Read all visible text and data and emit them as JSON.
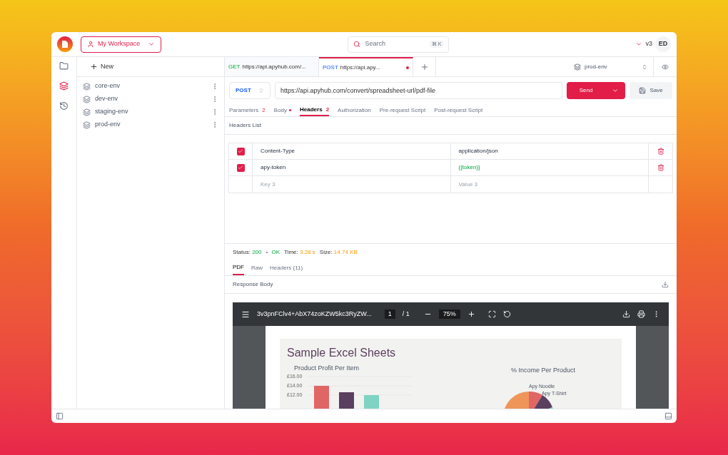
{
  "topbar": {
    "workspace": "My Workspace",
    "search": {
      "placeholder": "Search",
      "shortcut": "⌘ K"
    },
    "version": "v3",
    "avatar": "ED"
  },
  "rail": [
    {
      "kind": "folder",
      "selected": false
    },
    {
      "kind": "environments",
      "selected": true
    },
    {
      "kind": "history",
      "selected": false
    }
  ],
  "sidebar": {
    "new_label": "New",
    "items": [
      {
        "label": "core-env"
      },
      {
        "label": "dev-env"
      },
      {
        "label": "staging-env"
      },
      {
        "label": "prod-env"
      }
    ]
  },
  "request_tabs": [
    {
      "method": "GET",
      "url": "https://api.apyhub.com/...",
      "selected": false,
      "unsaved": false
    },
    {
      "method": "POST",
      "url": "https://api.apy...",
      "selected": true,
      "unsaved": true
    }
  ],
  "environment": "prod-env",
  "request": {
    "method": "POST",
    "url": "https://api.apyhub.com/convert/spreadsheet-url/pdf-file",
    "send": "Send",
    "save": "Save"
  },
  "sub_tabs": [
    {
      "label": "Parameters",
      "count": "2",
      "dot": false,
      "selected": false
    },
    {
      "label": "Body",
      "dot": true,
      "selected": false
    },
    {
      "label": "Headers",
      "count": "2",
      "dot": false,
      "selected": true
    },
    {
      "label": "Authorization",
      "dot": false,
      "selected": false
    },
    {
      "label": "Pre-request Script",
      "dot": false,
      "selected": false
    },
    {
      "label": "Post-request Script",
      "dot": false,
      "selected": false
    }
  ],
  "headers_title": "Headers List",
  "headers": [
    {
      "checked": true,
      "key": "Content-Type",
      "value": "application/json",
      "variable": false,
      "placeholder": false
    },
    {
      "checked": true,
      "key": "apy-token",
      "value": "{{token}}",
      "variable": true,
      "placeholder": false
    },
    {
      "checked": false,
      "key": "Key 3",
      "value": "Value 3",
      "variable": false,
      "placeholder": true
    }
  ],
  "status": {
    "status_label": "Status:",
    "code": "200",
    "text": "OK",
    "time_label": "Time:",
    "time": "3.28 s",
    "size_label": "Size:",
    "size": "14.74 KB"
  },
  "response_tabs": [
    {
      "label": "PDF",
      "selected": true
    },
    {
      "label": "Raw",
      "selected": false
    },
    {
      "label": "Headers (11)",
      "selected": false
    }
  ],
  "response_body_label": "Response Body",
  "pdf": {
    "file": "3v3pnFClv4+AbX74zoKZW5kc3RyZW...",
    "page": "1",
    "pages": "/ 1",
    "zoom": "75%",
    "doc_title": "Sample Excel Sheets",
    "bar_chart": {
      "title": "Product Profit Per Item",
      "y_labels": [
        "£16.00",
        "£14.00",
        "£12.00"
      ]
    },
    "pie_title": "% Income Per Product",
    "pie_labels": [
      "Apy Noodle",
      "Apy T-Shirt"
    ]
  }
}
